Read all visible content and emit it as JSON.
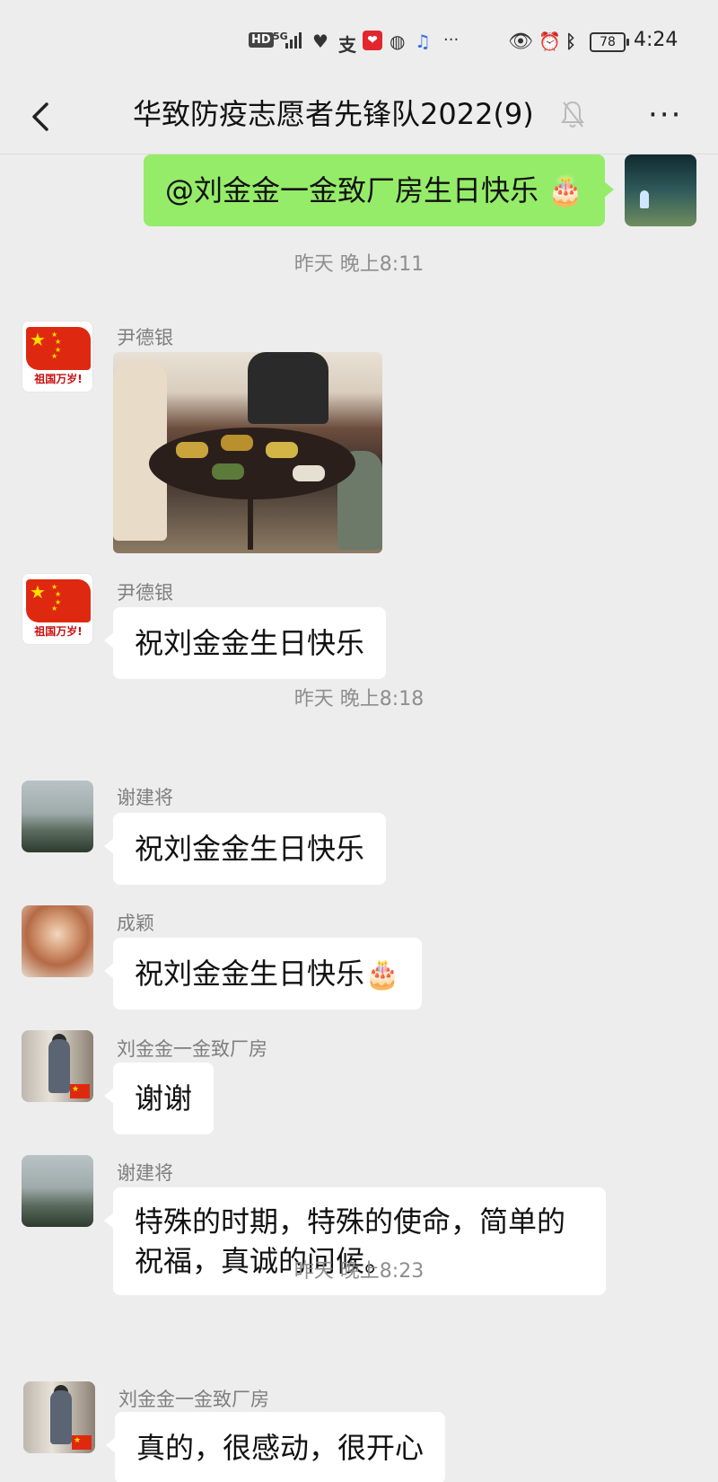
{
  "status_bar": {
    "hd": "HD",
    "network": "5G",
    "battery": "78",
    "time": "4:24",
    "more": "···"
  },
  "header": {
    "title": "华致防疫志愿者先锋队2022(9)",
    "more": "···"
  },
  "messages": [
    {
      "type": "text",
      "from_me": true,
      "text": "@刘金金一金致厂房生日快乐 🎂"
    },
    {
      "type": "time",
      "text": "昨天 晚上8:11"
    },
    {
      "type": "image",
      "sender": "尹德银",
      "avatar_caption": "祖国万岁!"
    },
    {
      "type": "text",
      "sender": "尹德银",
      "avatar_caption": "祖国万岁!",
      "text": "祝刘金金生日快乐"
    },
    {
      "type": "time",
      "text": "昨天 晚上8:18"
    },
    {
      "type": "text",
      "sender": "谢建将",
      "text": "祝刘金金生日快乐"
    },
    {
      "type": "text",
      "sender": "成颖",
      "text": "祝刘金金生日快乐🎂"
    },
    {
      "type": "text",
      "sender": "刘金金一金致厂房",
      "text": "谢谢"
    },
    {
      "type": "text",
      "sender": "谢建将",
      "text": "特殊的时期，特殊的使命，简单的祝福，真诚的问候。"
    },
    {
      "type": "time",
      "text": "昨天 晚上8:23"
    },
    {
      "type": "text",
      "sender": "刘金金一金致厂房",
      "text": "真的，很感动，很开心"
    }
  ],
  "colors": {
    "background": "#ededed",
    "my_bubble": "#95ec69",
    "other_bubble": "#ffffff",
    "timestamp": "#8e8e8e",
    "sender_name": "#7f7f7f"
  },
  "icons": [
    "back-arrow-icon",
    "mute-bell-icon",
    "more-options-icon",
    "signal-icon",
    "heart-rate-icon",
    "alipay-icon",
    "eye-icon",
    "alarm-icon",
    "bluetooth-icon",
    "battery-icon"
  ]
}
